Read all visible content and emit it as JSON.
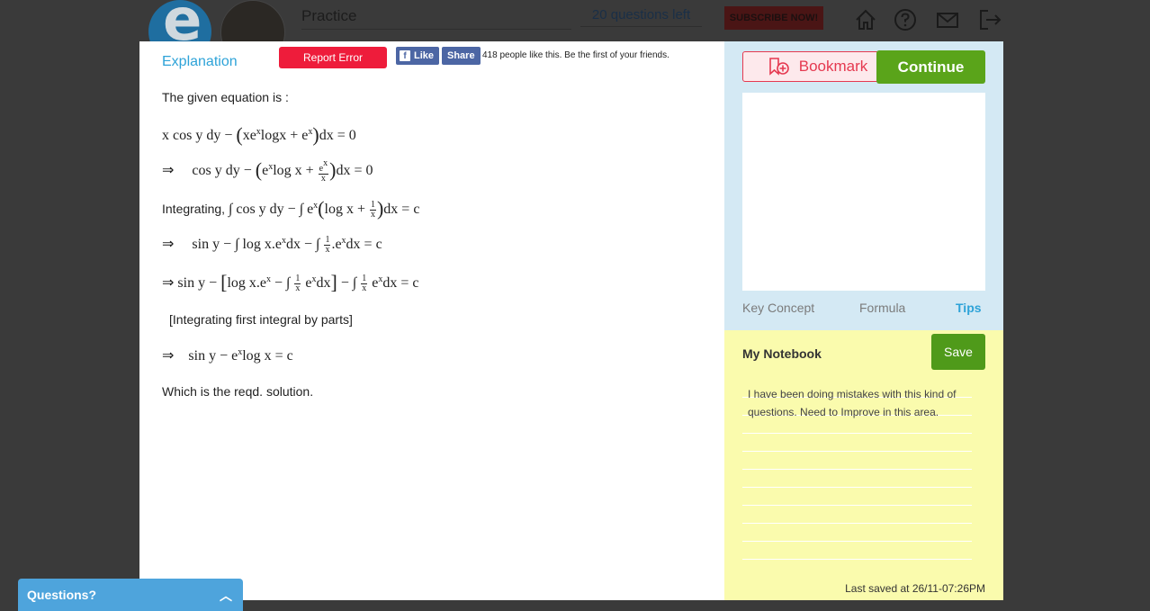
{
  "header": {
    "logo_letter": "e",
    "title": "Practice",
    "questions_left": "20 questions left",
    "subscribe_label": "SUBSCRIBE NOW!"
  },
  "explanation": {
    "title": "Explanation",
    "report_error": "Report Error",
    "fb_like": "Like",
    "fb_share": "Share",
    "fb_count": "418 people like this. Be the first of your friends.",
    "intro": "The given equation is :",
    "integrating": "Integrating,",
    "note": "[Integrating first integral by parts]",
    "conclusion": "Which is the reqd. solution."
  },
  "side": {
    "bookmark_label": "Bookmark",
    "continue_label": "Continue",
    "tabs": [
      "Key Concept",
      "Formula",
      "Tips"
    ],
    "active_tab": "Tips"
  },
  "notebook": {
    "title": "My Notebook",
    "save_label": "Save",
    "note_text": "I have been doing mistakes with this kind of questions. Need to Improve in this area.",
    "last_saved": "Last saved at 26/11-07:26PM"
  },
  "questions_bar": {
    "label": "Questions?"
  },
  "colors": {
    "accent_blue": "#2ea3d8",
    "report_red": "#ee1c3b",
    "continue_green": "#5aa41a",
    "notebook_yellow": "#fafbad"
  }
}
